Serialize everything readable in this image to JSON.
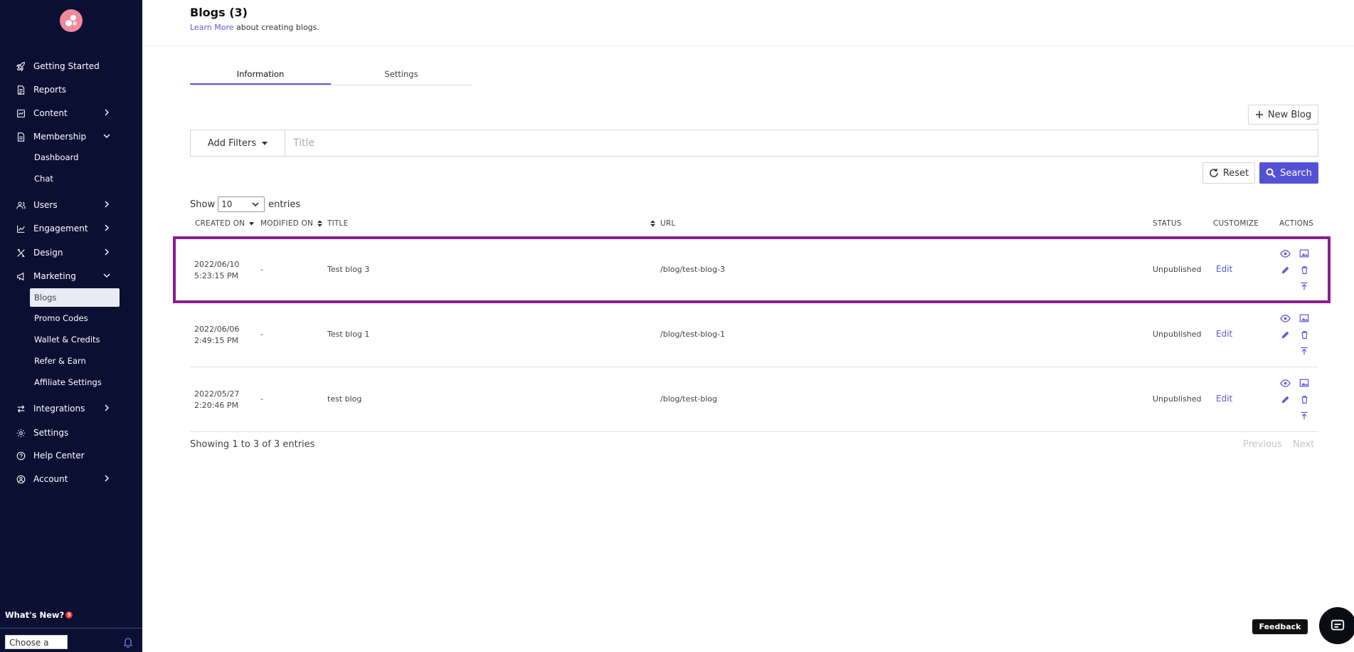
{
  "sidebar": {
    "logo": "logo",
    "items": [
      {
        "label": "Getting Started",
        "icon": "rocket-icon"
      },
      {
        "label": "Reports",
        "icon": "document-icon"
      },
      {
        "label": "Content",
        "icon": "content-icon",
        "chevron": "chevron-right-icon"
      },
      {
        "label": "Membership",
        "icon": "membership-icon",
        "chevron": "chevron-down-icon"
      },
      {
        "label": "Users",
        "icon": "users-icon",
        "chevron": "chevron-right-icon"
      },
      {
        "label": "Engagement",
        "icon": "chart-line-icon",
        "chevron": "chevron-right-icon"
      },
      {
        "label": "Design",
        "icon": "design-icon",
        "chevron": "chevron-right-icon"
      },
      {
        "label": "Marketing",
        "icon": "megaphone-icon",
        "chevron": "chevron-down-icon"
      },
      {
        "label": "Integrations",
        "icon": "arrows-icon",
        "chevron": "chevron-right-icon"
      },
      {
        "label": "Settings",
        "icon": "gear-icon"
      },
      {
        "label": "Help Center",
        "icon": "help-icon"
      },
      {
        "label": "Account",
        "icon": "account-icon",
        "chevron": "chevron-right-icon"
      }
    ],
    "membership_sub": [
      "Dashboard",
      "Chat"
    ],
    "marketing_sub": [
      "Blogs",
      "Promo Codes",
      "Wallet & Credits",
      "Refer & Earn",
      "Affiliate Settings"
    ],
    "whats_new": "What's New?",
    "whats_new_badge": "5",
    "plan_select": "Choose a plan"
  },
  "header": {
    "title": "Blogs (3)",
    "learn_more": "Learn More",
    "subtitle_rest": "about creating blogs."
  },
  "tabs": [
    "Information",
    "Settings"
  ],
  "toolbar": {
    "new_blog": "New Blog",
    "add_filters": "Add Filters",
    "title_placeholder": "Title",
    "reset": "Reset",
    "search": "Search"
  },
  "entries": {
    "show": "Show",
    "value": "10",
    "suffix": "entries"
  },
  "table": {
    "headers": [
      "CREATED ON",
      "MODIFIED ON",
      "TITLE",
      "URL",
      "STATUS",
      "CUSTOMIZE",
      "ACTIONS"
    ],
    "rows": [
      {
        "date": "2022/06/10",
        "time": "5:23:15 PM",
        "modified": "-",
        "title": "Test blog 3",
        "url": "/blog/test-blog-3",
        "status": "Unpublished",
        "customize": "Edit"
      },
      {
        "date": "2022/06/06",
        "time": "2:49:15 PM",
        "modified": "-",
        "title": "Test blog 1",
        "url": "/blog/test-blog-1",
        "status": "Unpublished",
        "customize": "Edit"
      },
      {
        "date": "2022/05/27",
        "time": "2:20:46 PM",
        "modified": "-",
        "title": "test blog",
        "url": "/blog/test-blog",
        "status": "Unpublished",
        "customize": "Edit"
      }
    ]
  },
  "footer": {
    "showing": "Showing 1 to 3 of 3 entries",
    "previous": "Previous",
    "next": "Next"
  },
  "feedback": "Feedback",
  "colors": {
    "sidebar_bg": "#0b1033",
    "accent": "#5352d5",
    "highlight": "#8a1f8f"
  }
}
